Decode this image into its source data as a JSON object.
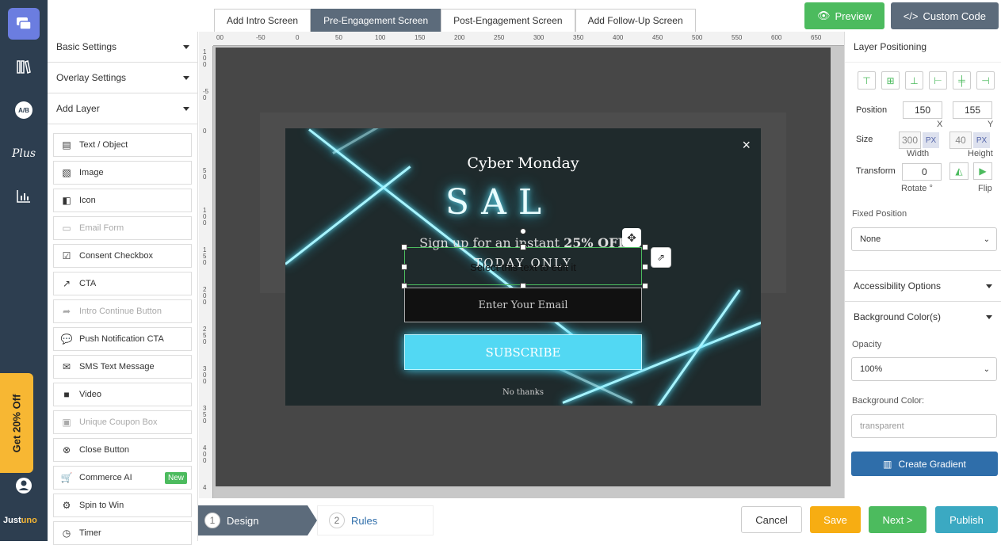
{
  "nav": {
    "icons": [
      "layers-icon",
      "library-icon",
      "ab-test-icon",
      "plus-icon",
      "chart-icon",
      "user-icon"
    ],
    "ab_label": "A/B",
    "plus_label": "Plus",
    "promo": "Get 20% Off",
    "brand_a": "Just",
    "brand_b": "uno"
  },
  "left_panel": {
    "sections": [
      "Basic Settings",
      "Overlay Settings",
      "Add Layer"
    ],
    "layers": [
      {
        "label": "Text / Object",
        "icon": "text-icon",
        "enabled": true
      },
      {
        "label": "Image",
        "icon": "image-icon",
        "enabled": true
      },
      {
        "label": "Icon",
        "icon": "icon-icon",
        "enabled": true
      },
      {
        "label": "Email Form",
        "icon": "form-icon",
        "enabled": false
      },
      {
        "label": "Consent Checkbox",
        "icon": "checkbox-icon",
        "enabled": true
      },
      {
        "label": "CTA",
        "icon": "external-link-icon",
        "enabled": true
      },
      {
        "label": "Intro Continue Button",
        "icon": "forward-icon",
        "enabled": false
      },
      {
        "label": "Push Notification CTA",
        "icon": "chat-icon",
        "enabled": true
      },
      {
        "label": "SMS Text Message",
        "icon": "sms-icon",
        "enabled": true
      },
      {
        "label": "Video",
        "icon": "video-icon",
        "enabled": true
      },
      {
        "label": "Unique Coupon Box",
        "icon": "coupon-icon",
        "enabled": false
      },
      {
        "label": "Close Button",
        "icon": "close-circle-icon",
        "enabled": true
      },
      {
        "label": "Commerce AI",
        "icon": "cart-icon",
        "enabled": true,
        "badge": "New"
      },
      {
        "label": "Spin to Win",
        "icon": "gear-icon",
        "enabled": true
      },
      {
        "label": "Timer",
        "icon": "clock-icon",
        "enabled": true
      }
    ]
  },
  "tabs": [
    "Add Intro Screen",
    "Pre-Engagement Screen",
    "Post-Engagement Screen",
    "Add Follow-Up Screen"
  ],
  "active_tab": 1,
  "toolbar": {
    "preview": "Preview",
    "custom_code": "Custom Code"
  },
  "ruler": {
    "top": [
      "00",
      "-50",
      "0",
      "50",
      "100",
      "150",
      "200",
      "250",
      "300",
      "350",
      "400",
      "450",
      "500",
      "550",
      "600",
      "650"
    ],
    "left": [
      "100",
      "-50",
      "0",
      "50",
      "100",
      "150",
      "200",
      "250",
      "300",
      "350",
      "400",
      "4"
    ]
  },
  "popup": {
    "headline": "Cyber Monday",
    "sale": "SAL",
    "subline": "Sign up for an instant ",
    "subline_bold": "25% OFF",
    "today": "TODAY ONLY",
    "selection_hint": "Select this text to edit it",
    "email_placeholder": "Enter Your Email",
    "subscribe": "SUBSCRIBE",
    "no_thanks": "No thanks",
    "close": "×"
  },
  "right_panel": {
    "title": "Layer Positioning",
    "position_label": "Position",
    "x": "150",
    "y": "155",
    "x_label": "X",
    "y_label": "Y",
    "size_label": "Size",
    "width": "300",
    "height": "40",
    "unit": "PX",
    "width_label": "Width",
    "height_label": "Height",
    "transform_label": "Transform",
    "rotate": "0",
    "rotate_label": "Rotate °",
    "flip_label": "Flip",
    "fixed_position_label": "Fixed Position",
    "fixed_position_value": "None",
    "accessibility": "Accessibility Options",
    "background_colors": "Background Color(s)",
    "opacity_label": "Opacity",
    "opacity_value": "100%",
    "bg_color_label": "Background Color:",
    "bg_color_value": "transparent",
    "create_gradient": "Create Gradient"
  },
  "bottom": {
    "step1_num": "1",
    "step1": "Design",
    "step2_num": "2",
    "step2": "Rules",
    "cancel": "Cancel",
    "save": "Save",
    "next": "Next >",
    "publish": "Publish"
  },
  "colors": {
    "nav": "#2d3e50",
    "accent_green": "#4cbb5e",
    "save_orange": "#f7ad12",
    "publish_teal": "#3ba9c2",
    "neon_cyan": "#52d8f3"
  }
}
